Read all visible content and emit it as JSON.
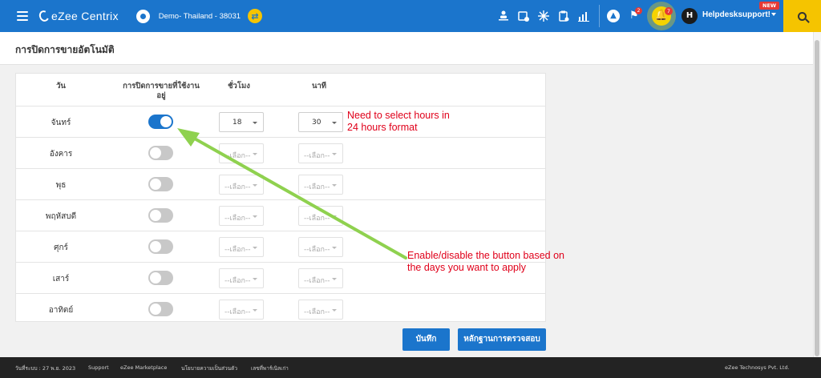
{
  "topbar": {
    "app_name": "eZee Centrix",
    "property": "Demo- Thailand -  38031",
    "flag_count": "2",
    "bell_count": "7",
    "avatar_letter": "H",
    "user_name": "Helpdesksupport!",
    "new_badge": "NEW",
    "swap_symbol": "⇄",
    "icons": [
      "menu-icon",
      "globe-icon",
      "swap-icon",
      "users-icon",
      "calendar-icon",
      "network-icon",
      "clipboard-icon",
      "chart-icon",
      "alert-icon",
      "flag-icon",
      "bell-icon",
      "search-icon"
    ],
    "accent": "#1b75cc",
    "highlight": "#f5c400"
  },
  "page": {
    "title": "การปิดการขายอัตโนมัติ"
  },
  "table": {
    "headers": {
      "day": "วัน",
      "active": "การปิดการขายที่ใช้งานอยู่",
      "hours": "ชั่วโมง",
      "minutes": "นาที"
    },
    "rows": [
      {
        "day": "จันทร์",
        "enabled": true,
        "hour": "18",
        "minute": "30"
      },
      {
        "day": "อังคาร",
        "enabled": false,
        "hour": "--เลือก--",
        "minute": "--เลือก--"
      },
      {
        "day": "พุธ",
        "enabled": false,
        "hour": "--เลือก--",
        "minute": "--เลือก--"
      },
      {
        "day": "พฤหัสบดี",
        "enabled": false,
        "hour": "--เลือก--",
        "minute": "--เลือก--"
      },
      {
        "day": "ศุกร์",
        "enabled": false,
        "hour": "--เลือก--",
        "minute": "--เลือก--"
      },
      {
        "day": "เสาร์",
        "enabled": false,
        "hour": "--เลือก--",
        "minute": "--เลือก--"
      },
      {
        "day": "อาทิตย์",
        "enabled": false,
        "hour": "--เลือก--",
        "minute": "--เลือก--"
      }
    ]
  },
  "actions": {
    "save": "บันทึก",
    "audit": "หลักฐานการตรวจสอบ"
  },
  "annotations": {
    "hours_line1": "Need to select hours in",
    "hours_line2": "24 hours format",
    "toggle_line1": "Enable/disable the button based on",
    "toggle_line2": "the days you want to apply",
    "arrow_color": "#8fd14f",
    "text_color": "#e0001a"
  },
  "footer": {
    "date": "วันที่ระบบ : 27 พ.ย. 2023",
    "support": "Support",
    "marketplace": "eZee Marketplace",
    "privacy": "นโยบายความเป็นส่วนตัว",
    "ref": "เลขที่พาร์เนิลเก่า",
    "copyright": "eZee Technosys Pvt. Ltd."
  }
}
